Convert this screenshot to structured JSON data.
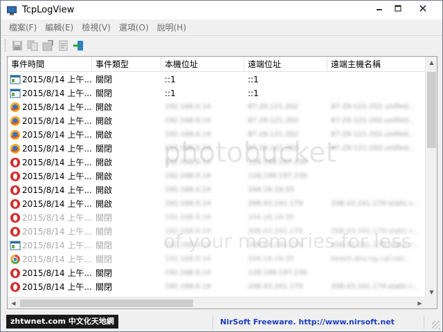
{
  "window": {
    "title": "TcpLogView"
  },
  "menu": [
    "檔案(F)",
    "編輯(E)",
    "檢視(V)",
    "選項(O)",
    "說明(H)"
  ],
  "columns": [
    "事件時間",
    "事件類型",
    "本機位址",
    "遠端位址",
    "遠端主機名稱"
  ],
  "rows": [
    {
      "icon": "window-icon",
      "time": "2015/8/14 上午...",
      "type": "關閉",
      "local": "::1",
      "remote": "::1",
      "host": "",
      "blur": false,
      "faded": false
    },
    {
      "icon": "window-icon",
      "time": "2015/8/14 上午...",
      "type": "關閉",
      "local": "::1",
      "remote": "::1",
      "host": "",
      "blur": false,
      "faded": false
    },
    {
      "icon": "firefox-icon",
      "time": "2015/8/14 上午...",
      "type": "開啟",
      "local": "192.168.0.14",
      "remote": "87.29.121.202",
      "host": "87-29-121-202.unified...",
      "blur": true,
      "faded": false
    },
    {
      "icon": "firefox-icon",
      "time": "2015/8/14 上午...",
      "type": "開啟",
      "local": "192.168.0.14",
      "remote": "87.29.121.202",
      "host": "87-29-121-202.unified...",
      "blur": true,
      "faded": false
    },
    {
      "icon": "firefox-icon",
      "time": "2015/8/14 上午...",
      "type": "開啟",
      "local": "192.168.0.14",
      "remote": "87.29.121.202",
      "host": "87-29-121-202.unified...",
      "blur": true,
      "faded": false
    },
    {
      "icon": "firefox-icon",
      "time": "2015/8/14 上午...",
      "type": "關閉",
      "local": "192.168.0.14",
      "remote": "87.29.121.202",
      "host": "87-29-121-202.unified...",
      "blur": true,
      "faded": false
    },
    {
      "icon": "opera-icon",
      "time": "2015/8/14 上午...",
      "type": "開啟",
      "local": "192.168.0.14",
      "remote": "128.199.197.230",
      "host": "",
      "blur": true,
      "faded": false
    },
    {
      "icon": "opera-icon",
      "time": "2015/8/14 上午...",
      "type": "開啟",
      "local": "192.168.0.14",
      "remote": "128.199.197.230",
      "host": "",
      "blur": true,
      "faded": false
    },
    {
      "icon": "opera-icon",
      "time": "2015/8/14 上午...",
      "type": "開啟",
      "local": "192.168.0.14",
      "remote": "104.16.19.55",
      "host": "",
      "blur": true,
      "faded": false
    },
    {
      "icon": "opera-icon",
      "time": "2015/8/14 上午...",
      "type": "開啟",
      "local": "192.168.0.14",
      "remote": "208.43.241.179",
      "host": "208.43.241.179-static.r...",
      "blur": true,
      "faded": false
    },
    {
      "icon": "opera-icon",
      "time": "2015/8/14 上午...",
      "type": "關閉",
      "local": "192.168.0.14",
      "remote": "104.16.19.55",
      "host": "",
      "blur": true,
      "faded": true
    },
    {
      "icon": "opera-icon",
      "time": "2015/8/14 上午...",
      "type": "關閉",
      "local": "192.168.0.14",
      "remote": "208.43.241.179",
      "host": "208.43.241.179-static.r...",
      "blur": true,
      "faded": true
    },
    {
      "icon": "window-icon",
      "time": "2015/8/14 上午...",
      "type": "關閉",
      "local": "192.168.0.14",
      "remote": "208.43.241.179",
      "host": "208.43.241.179-static.r...",
      "blur": true,
      "faded": true
    },
    {
      "icon": "chrome-icon",
      "time": "2015/8/14 上午...",
      "type": "關閉",
      "local": "192.168.0.14",
      "remote": "104.16.19.55",
      "host": "beach.dns.ng.cqf.cdn...",
      "blur": true,
      "faded": true
    },
    {
      "icon": "opera-icon",
      "time": "2015/8/14 上午...",
      "type": "關閉",
      "local": "192.168.0.14",
      "remote": "128.199.197.230",
      "host": "",
      "blur": true,
      "faded": false
    },
    {
      "icon": "opera-icon",
      "time": "2015/8/14 上午...",
      "type": "關閉",
      "local": "192.168.0.14",
      "remote": "208.43.241.179",
      "host": "208.43.241.179-static.r...",
      "blur": true,
      "faded": false
    }
  ],
  "status": {
    "badge": "zhtwnet.com 中文化天地網",
    "link": "NirSoft Freeware.  http://www.nirsoft.net"
  },
  "watermark": {
    "line1": "photobucket",
    "line2": "of your memories for less"
  },
  "colors": {
    "link": "#1f3fbf",
    "title_bg": "#ffffff"
  }
}
